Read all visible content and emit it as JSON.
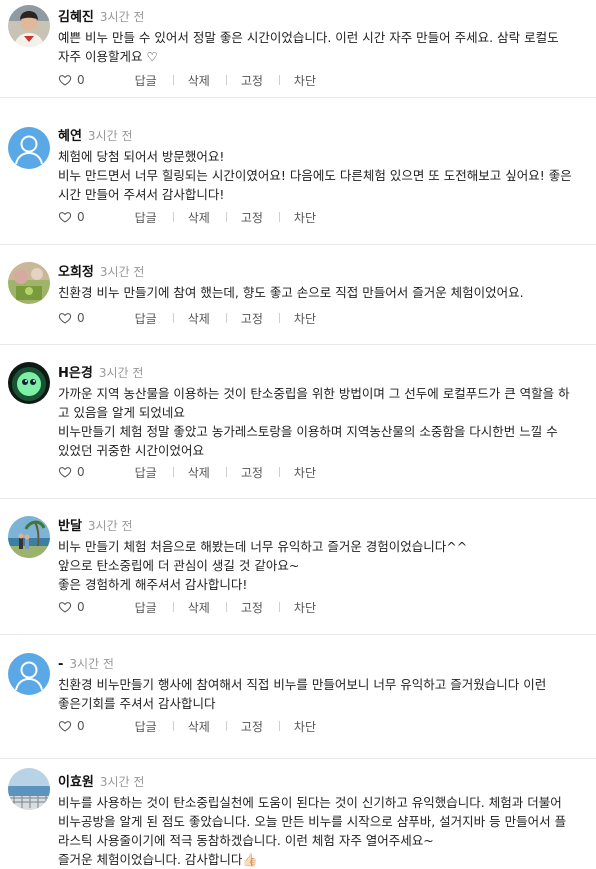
{
  "comments": [
    {
      "author": "김혜진",
      "time": "3시간 전",
      "lines": [
        "예쁜 비누 만들 수 있어서 정말 좋은 시간이었습니다. 이런 시간 자주 만들어 주세요. 삼락 로컬도",
        "자주 이용할게요 ♡"
      ],
      "likes": "0"
    },
    {
      "author": "혜연",
      "time": "3시간 전",
      "lines": [
        "체험에 당첨 되어서 방문했어요!",
        "비누 만드면서 너무 힐링되는 시간이였어요! 다음에도 다른체험 있으면 또 도전해보고 싶어요! 좋은",
        "시간 만들어 주셔서 감사합니다!"
      ],
      "likes": "0"
    },
    {
      "author": "오희정",
      "time": "3시간 전",
      "lines": [
        "친환경 비누 만들기에 참여 했는데, 향도 좋고 손으로 직접 만들어서  즐거운 체험이었어요."
      ],
      "likes": "0"
    },
    {
      "author": "H은경",
      "time": "3시간 전",
      "lines": [
        "가까운 지역 농산물을 이용하는 것이 탄소중립을 위한 방법이며 그 선두에 로컬푸드가 큰 역할을 하",
        "고 있음을 알게 되었네요",
        "비누만들기 체험 정말 좋았고 농가레스토랑을 이용하며 지역농산물의 소중함을 다시한번 느낄 수",
        "있었던 귀중한 시간이었어요"
      ],
      "likes": "0"
    },
    {
      "author": "반달",
      "time": "3시간 전",
      "lines": [
        "비누 만들기 체험 처음으로 해봤는데 너무 유익하고 즐거운 경험이었습니다^^",
        "앞으로 탄소중립에 더 관심이 생길 것 같아요~",
        "좋은 경험하게 해주셔서 감사합니다!"
      ],
      "likes": "0"
    },
    {
      "author": "-",
      "time": "3시간 전",
      "lines": [
        "친환경  비누만들기 행사에 참여해서 직접 비누를 만들어보니  너무 유익하고 즐거웠습니다  이런",
        "좋은기회를 주셔서 감사합니다"
      ],
      "likes": "0"
    },
    {
      "author": "이효원",
      "time": "3시간 전",
      "lines": [
        "비누를 사용하는 것이 탄소중립실천에 도움이 된다는 것이 신기하고 유익했습니다. 체험과 더불어",
        "비누공방을 알게 된 점도 좋았습니다. 오늘 만든 비누를 시작으로 샴푸바, 설거지바 등 만들어서 플",
        "라스틱 사용줄이기에 적극 동참하겠습니다. 이런 체험 자주 열어주세요~",
        "즐거운 체험이었습니다. 감사합니다👍🏻"
      ],
      "likes": "0"
    }
  ],
  "actions": {
    "reply": "답글",
    "delete": "삭제",
    "pin": "고정",
    "block": "차단"
  },
  "icons": {
    "like": "heart-outline-icon"
  },
  "colors": {
    "default_avatar": "#5aa9e6",
    "time": "#999999",
    "divider": "#e9e9e9"
  }
}
